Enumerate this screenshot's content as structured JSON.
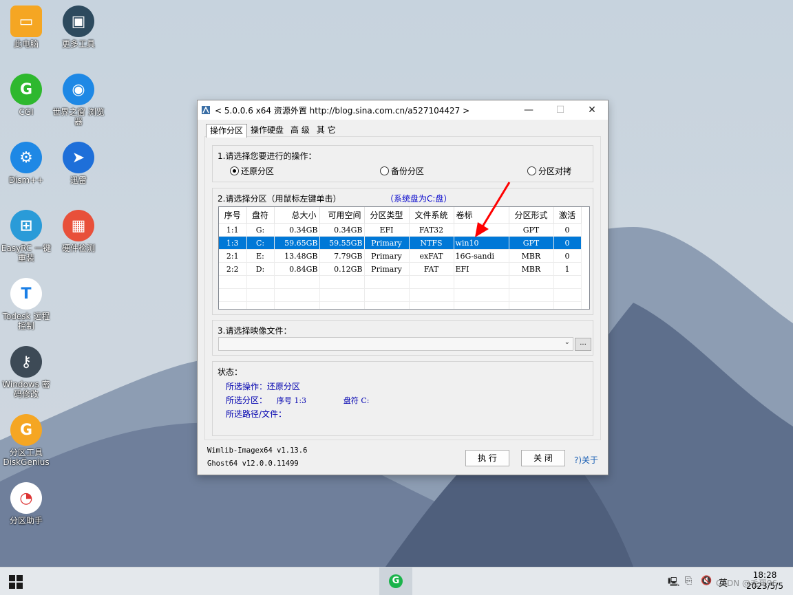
{
  "desktop": {
    "icons": [
      {
        "label": "此电脑",
        "icon": "this-pc-icon",
        "color": "#f5a623"
      },
      {
        "label": "更多工具",
        "icon": "toolbox-icon",
        "color": "#2d4a5e"
      },
      {
        "label": "CGI",
        "icon": "cgi-icon",
        "color": "#2eb82e"
      },
      {
        "label": "世界之窗 浏览器",
        "icon": "browser-icon",
        "color": "#1e88e5"
      },
      {
        "label": "Dism++",
        "icon": "dism-icon",
        "color": "#1e88e5"
      },
      {
        "label": "迅雷",
        "icon": "thunder-icon",
        "color": "#1e6fd9"
      },
      {
        "label": "EasyRC 一键重装",
        "icon": "windows-icon",
        "color": "#2a9bd8"
      },
      {
        "label": "硬件检测",
        "icon": "chip-icon",
        "color": "#e8503a"
      },
      {
        "label": "Todesk 远程控制",
        "icon": "todesk-icon",
        "color": "#ffffff"
      },
      {
        "label": "Windows 密码修改",
        "icon": "key-icon",
        "color": "#3d4a56"
      },
      {
        "label": "分区工具 DiskGenius",
        "icon": "diskgenius-icon",
        "color": "#f5a623"
      },
      {
        "label": "分区助手",
        "icon": "partition-assistant-icon",
        "color": "#ffffff"
      }
    ]
  },
  "window": {
    "title": "< 5.0.0.6 x64 资源外置 http://blog.sina.com.cn/a527104427 >",
    "min_glyph": "—",
    "max_glyph": "☐",
    "close_glyph": "✕"
  },
  "tabs": [
    "操作分区",
    "操作硬盘",
    "高 级",
    "其 它"
  ],
  "section1": {
    "label": "1.请选择您要进行的操作：",
    "options": [
      "还原分区",
      "备份分区",
      "分区对拷"
    ],
    "selected": 0
  },
  "section2": {
    "label": "2.请选择分区（用鼠标左键单击）",
    "system_hint": "（系统盘为C:盘）",
    "columns": [
      "序号",
      "盘符",
      "总大小",
      "可用空间",
      "分区类型",
      "文件系统",
      "卷标",
      "分区形式",
      "激活"
    ],
    "rows": [
      [
        "1:1",
        "G:",
        "0.34GB",
        "0.34GB",
        "EFI",
        "FAT32",
        "",
        "GPT",
        "0"
      ],
      [
        "1:3",
        "C:",
        "59.65GB",
        "59.55GB",
        "Primary",
        "NTFS",
        "win10",
        "GPT",
        "0"
      ],
      [
        "2:1",
        "E:",
        "13.48GB",
        "7.79GB",
        "Primary",
        "exFAT",
        "16G-sandi",
        "MBR",
        "0"
      ],
      [
        "2:2",
        "D:",
        "0.84GB",
        "0.12GB",
        "Primary",
        "FAT",
        "EFI",
        "MBR",
        "1"
      ]
    ],
    "selected_row": 1,
    "annotation_color": "#ff0000"
  },
  "section3": {
    "label": "3.请选择映像文件：",
    "value": "",
    "browse_label": "..."
  },
  "status": {
    "label": "状态：",
    "op_label": "所选操作：",
    "op_value": "还原分区",
    "part_label": "所选分区：",
    "part_value": "序号 1:3",
    "drive_value": "盘符 C:",
    "path_label": "所选路径/文件："
  },
  "footer": {
    "wimlib": "Wimlib-Imagex64 v1.13.6",
    "ghost": "Ghost64 v12.0.0.11499",
    "execute": "执 行",
    "close": "关 闭",
    "about": "?)关于"
  },
  "taskbar": {
    "time": "18:28",
    "date": "2023/5/5",
    "ime": "英",
    "watermark": "CSDN @毛哥96"
  },
  "colors": {
    "selection": "#0078d7",
    "status_text": "#0000b0",
    "hint_text": "#0000cc"
  }
}
